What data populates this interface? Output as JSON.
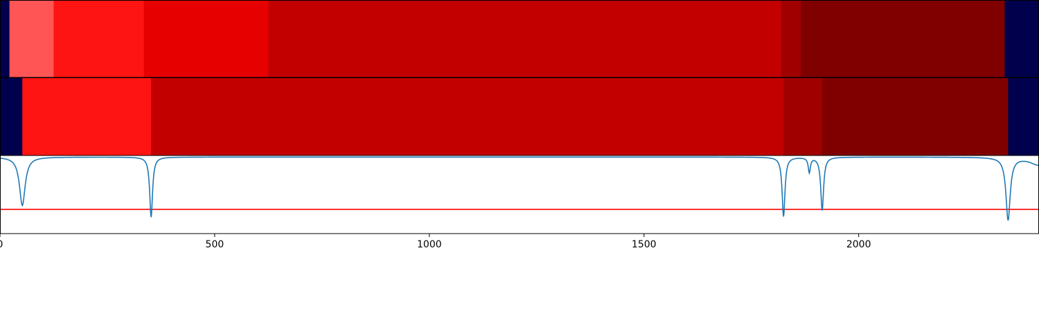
{
  "chart_data": [
    {
      "type": "heatmap",
      "x": {
        "min": 0,
        "max": 2420
      },
      "segments": [
        {
          "start": 0,
          "end": 22,
          "color": "#00004c"
        },
        {
          "start": 22,
          "end": 125,
          "color": "#ff5555"
        },
        {
          "start": 125,
          "end": 335,
          "color": "#ff1414"
        },
        {
          "start": 335,
          "end": 625,
          "color": "#e60000"
        },
        {
          "start": 625,
          "end": 1820,
          "color": "#c20000"
        },
        {
          "start": 1820,
          "end": 1865,
          "color": "#a00000"
        },
        {
          "start": 1865,
          "end": 2340,
          "color": "#800000"
        },
        {
          "start": 2340,
          "end": 2420,
          "color": "#00004c"
        }
      ]
    },
    {
      "type": "heatmap",
      "x": {
        "min": 0,
        "max": 2420
      },
      "segments": [
        {
          "start": 0,
          "end": 52,
          "color": "#00004c"
        },
        {
          "start": 52,
          "end": 352,
          "color": "#ff1414"
        },
        {
          "start": 352,
          "end": 1825,
          "color": "#c20000"
        },
        {
          "start": 1825,
          "end": 1915,
          "color": "#a00000"
        },
        {
          "start": 1915,
          "end": 2348,
          "color": "#800000"
        },
        {
          "start": 2348,
          "end": 2420,
          "color": "#00004c"
        }
      ]
    },
    {
      "type": "line",
      "x": {
        "min": 0,
        "max": 2420
      },
      "ylim": [
        0,
        1
      ],
      "xticks": [
        0,
        500,
        1000,
        1500,
        2000
      ],
      "xtick_labels": [
        "0",
        "500",
        "1000",
        "1500",
        "2000"
      ],
      "baseline": 0.98,
      "threshold": {
        "value": 0.31,
        "color": "#ff0000"
      },
      "line_color": "#1f77b4",
      "dips": [
        {
          "x": 52,
          "depth": 0.62,
          "width": 8
        },
        {
          "x": 352,
          "depth": 0.77,
          "width": 4
        },
        {
          "x": 1825,
          "depth": 0.76,
          "width": 4
        },
        {
          "x": 1885,
          "depth": 0.19,
          "width": 3
        },
        {
          "x": 1915,
          "depth": 0.68,
          "width": 4
        },
        {
          "x": 2348,
          "depth": 0.8,
          "width": 6
        },
        {
          "x": 2420,
          "depth": 0.1,
          "width": 25
        }
      ]
    }
  ]
}
